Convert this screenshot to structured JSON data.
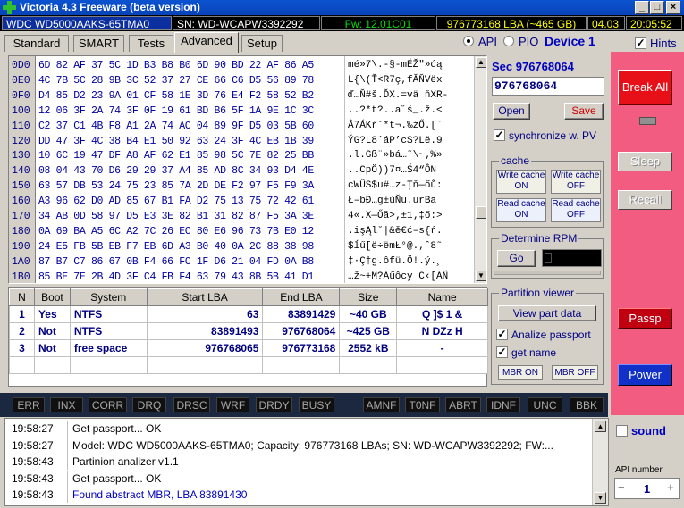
{
  "window": {
    "title": "Victoria 4.3 Freeware (beta version)"
  },
  "infobar": {
    "model": "WDC WD5000AAKS-65TMA0",
    "serial": "SN: WD-WCAPW3392292",
    "firmware": "Fw: 12.01C01",
    "lba": "976773168 LBA (~465 GB)",
    "date": "04.03",
    "time": "20:05:52"
  },
  "tabs": [
    "Standard",
    "SMART",
    "Tests",
    "Advanced",
    "Setup"
  ],
  "mode": {
    "api": "API",
    "pio": "PIO",
    "device": "Device 1",
    "hints": "Hints"
  },
  "hex": [
    {
      "a": "0D0",
      "h": "6D 82 AF 37 5C 1D B3 B8 B0 6D 90 BD 22 AF 86 A5",
      "s": "mé»7\\.-§-mÉŽ\"»ćą"
    },
    {
      "a": "0E0",
      "h": "4C 7B 5C 28 9B 3C 52 37 27 CE 66 C6 D5 56 89 78",
      "s": "L{\\(Ť<R7ç,fĂŇVëx"
    },
    {
      "a": "0F0",
      "h": "D4 85 D2 23 9A 01 CF 58 1E 3D 76 E4 F2 58 52 B2",
      "s": "ď…Ň#š.ĎX.=vä ňXR-"
    },
    {
      "a": "100",
      "h": "12 06 3F 2A 74 3F 0F 19 61 BD B6 5F 1A 9E 1C 3C",
      "s": "..?*t?..a˝ś_.ž.<"
    },
    {
      "a": "110",
      "h": "C2 37 C1 4B F8 A1 2A 74 AC 04 89 9F D5 03 5B 60",
      "s": "Â7ÁKř˘*t¬.‰źŐ.[`"
    },
    {
      "a": "120",
      "h": "DD 47 3F 4C 38 B4 E1 50 92 63 24 3F 4C EB 1B 39",
      "s": "ÝG?L8´áP’c$?Lë.9"
    },
    {
      "a": "130",
      "h": "10 6C 19 47 DF A8 AF 62 E1 85 98 5C 7E 82 25 BB",
      "s": ".l.Gß¨»bá…˜\\~‚%»"
    },
    {
      "a": "140",
      "h": "08 04 43 70 D6 29 29 37 A4 85 AD 8C 34 93 D4 4E",
      "s": "..CpÖ))7¤…­Ś4“ÔN"
    },
    {
      "a": "150",
      "h": "63 57 DB 53 24 75 23 85 7A 2D DE F2 97 F5 F9 3A",
      "s": "cWŰS$u#…z-Ţň—őů:"
    },
    {
      "a": "160",
      "h": "A3 96 62 D0 AD 85 67 B1 FA D2 75 13 75 72 42 61",
      "s": "Ł–bĐ­…g±úŇu.urBa"
    },
    {
      "a": "170",
      "h": "34 AB 0D 58 97 D5 E3 3E 82 B1 31 82 87 F5 3A 3E",
      "s": "4«.X—Őă>‚±1‚‡ő:>"
    },
    {
      "a": "180",
      "h": "0A 69 BA A5 6C A2 7C 26 EC 80 E6 96 73 7B E0 12",
      "s": ".işĄl˘|&ě€ć–s{ŕ."
    },
    {
      "a": "190",
      "h": "24 E5 FB 5B EB F7 EB 6D A3 B0 40 0A 2C 88 38 98",
      "s": "$ĺű[ë÷ëmŁ°@.,ˆ8˜"
    },
    {
      "a": "1A0",
      "h": "87 B7 C7 86 67 0B F4 66 FC 1F D6 21 04 FD 0A B8",
      "s": "‡·Ç†g.ôfü.Ö!.ý.¸"
    },
    {
      "a": "1B0",
      "h": "85 BE 7E 2B 4D 3F C4 FB F4 63 79 43 8B 5B 41 D1",
      "s": "…ž~+M?Äűôcy C‹[AŃ"
    }
  ],
  "sector": {
    "label": "Sec 976768064",
    "value": "976768064",
    "open": "Open",
    "save": "Save",
    "sync": "synchronize w. PV"
  },
  "cache": {
    "title": "cache",
    "wr_on": "Write cache ON",
    "wr_off": "Write cache OFF",
    "rd_on": "Read cache ON",
    "rd_off": "Read cache OFF"
  },
  "rpm": {
    "title": "Determine RPM",
    "go": "Go"
  },
  "partview": {
    "title": "Partition viewer",
    "view": "View part data",
    "analize": "Analize passport",
    "getname": "get name",
    "mbr_on": "MBR ON",
    "mbr_off": "MBR OFF"
  },
  "ptable": {
    "headers": [
      "N",
      "Boot",
      "System",
      "Start LBA",
      "End LBA",
      "Size",
      "Name"
    ],
    "rows": [
      [
        "1",
        "Yes",
        "NTFS",
        "63",
        "83891429",
        "~40 GB",
        "Q ]$ 1  &"
      ],
      [
        "2",
        "Not",
        "NTFS",
        "83891493",
        "976768064",
        "~425 GB",
        "N  DZz  H"
      ],
      [
        "3",
        "Not",
        "free space",
        "976768065",
        "976773168",
        "2552 kB",
        "-"
      ]
    ]
  },
  "flags": [
    "ERR",
    "INX",
    "CORR",
    "DRQ",
    "DRSC",
    "WRF",
    "DRDY",
    "BUSY",
    "AMNF",
    "T0NF",
    "ABRT",
    "IDNF",
    "UNC",
    "BBK"
  ],
  "log": [
    {
      "t": "19:58:27",
      "m": "Get passport... OK",
      "c": "#000"
    },
    {
      "t": "19:58:27",
      "m": "Model: WDC WD5000AAKS-65TMA0; Capacity: 976773168 LBAs; SN: WD-WCAPW3392292; FW:...",
      "c": "#000"
    },
    {
      "t": "19:58:43",
      "m": "Partinion analizer v1.1",
      "c": "#000"
    },
    {
      "t": "19:58:43",
      "m": "Get passport... OK",
      "c": "#000"
    },
    {
      "t": "19:58:43",
      "m": "Found abstract MBR, LBA 83891430",
      "c": "#0000c0"
    }
  ],
  "right": {
    "break": "Break All",
    "sleep": "Sleep",
    "recall": "Recall",
    "passp": "Passp",
    "power": "Power",
    "sound": "sound",
    "api_label": "API number",
    "api_value": "1"
  }
}
